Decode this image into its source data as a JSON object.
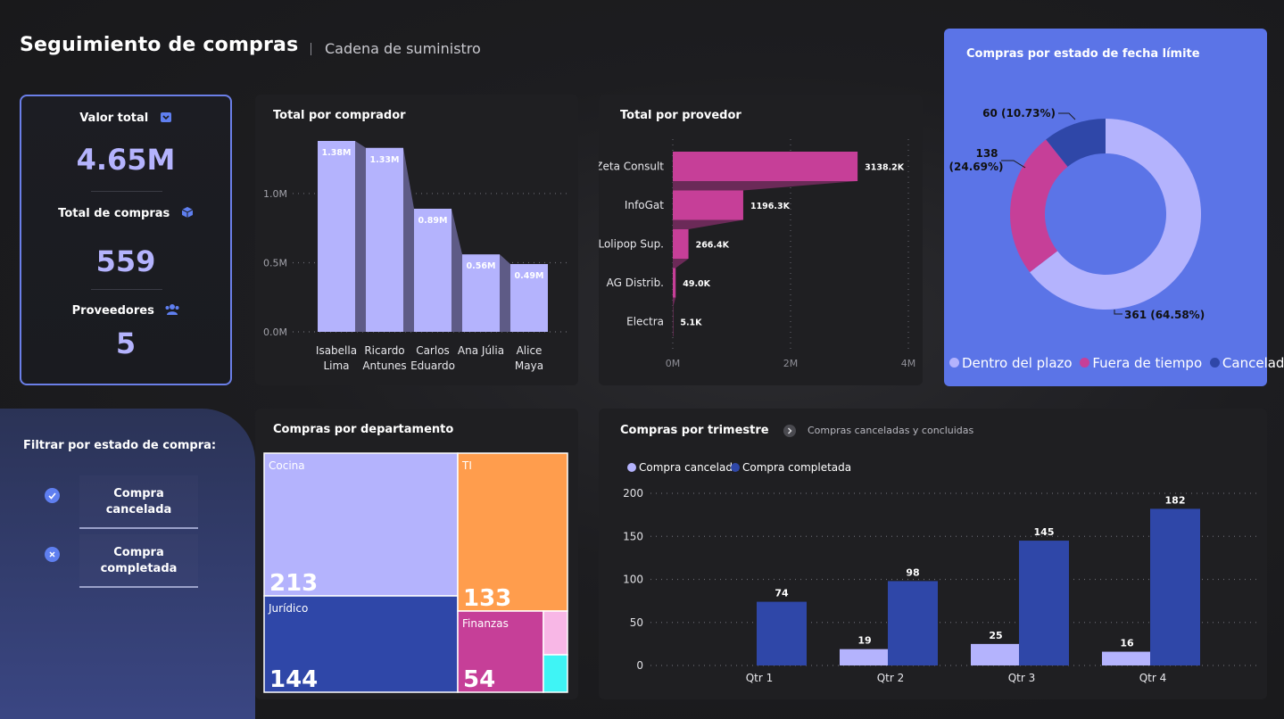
{
  "header": {
    "title": "Seguimiento de compras",
    "subtitle": "Cadena de suministro"
  },
  "kpis": {
    "total_value_label": "Valor total",
    "total_value": "4.65M",
    "total_purchases_label": "Total de compras",
    "total_purchases": "559",
    "suppliers_label": "Proveedores",
    "suppliers": "5"
  },
  "filters": {
    "title": "Filtrar por estado de compra:",
    "items": [
      {
        "line1": "Compra",
        "line2": "cancelada",
        "icon": "check-circle-icon"
      },
      {
        "line1": "Compra",
        "line2": "completada",
        "icon": "x-circle-icon"
      }
    ]
  },
  "colors": {
    "lavender": "#b4b3fd",
    "magenta": "#c63f98",
    "navy": "#2f47a8",
    "orange": "#ff9d4d",
    "donut_bg": "#5b74e7",
    "cyan": "#3ff4f5",
    "pink": "#f8b7e6"
  },
  "charts": {
    "buyer": {
      "title": "Total por comprador",
      "chart_data": {
        "type": "bar",
        "categories": [
          "Isabella Lima",
          "Ricardo Antunes",
          "Carlos Eduardo",
          "Ana Júlia",
          "Alice Maya"
        ],
        "category_lines": [
          [
            "Isabella",
            "Lima"
          ],
          [
            "Ricardo",
            "Antunes"
          ],
          [
            "Carlos",
            "Eduardo"
          ],
          [
            "Ana Júlia"
          ],
          [
            "Alice",
            "Maya"
          ]
        ],
        "values": [
          1.38,
          1.33,
          0.89,
          0.56,
          0.49
        ],
        "labels": [
          "1.38M",
          "1.33M",
          "0.89M",
          "0.56M",
          "0.49M"
        ],
        "yticks": [
          "0.0M",
          "0.5M",
          "1.0M"
        ],
        "ytick_values": [
          0,
          0.5,
          1.0
        ],
        "ylim": [
          0,
          1.38
        ]
      }
    },
    "supplier": {
      "title": "Total por provedor",
      "chart_data": {
        "type": "bar",
        "orientation": "horizontal",
        "categories": [
          "Zeta Consult",
          "InfoGat",
          "Lolipop Sup.",
          "AG Distrib.",
          "Electra"
        ],
        "values": [
          3138.2,
          1196.3,
          266.4,
          49.0,
          5.1
        ],
        "labels": [
          "3138.2K",
          "1196.3K",
          "266.4K",
          "49.0K",
          "5.1K"
        ],
        "xticks": [
          "0M",
          "2M",
          "4M"
        ],
        "xtick_values": [
          0,
          2000,
          4000
        ],
        "xlim": [
          0,
          4000
        ]
      }
    },
    "deadline": {
      "title": "Compras por estado de fecha límite",
      "chart_data": {
        "type": "pie",
        "categories": [
          "Dentro del plazo",
          "Fuera de tiempo",
          "Cancelada"
        ],
        "values": [
          361,
          138,
          60
        ],
        "labels": [
          "361 (64.58%)",
          "138",
          "(24.69%)",
          "60 (10.73%)"
        ],
        "legend": "bottom"
      }
    },
    "department": {
      "title": "Compras por departamento",
      "chart_data": {
        "type": "treemap",
        "categories": [
          "Cocina",
          "Jurídico",
          "TI",
          "Finanzas"
        ],
        "values": [
          213,
          144,
          133,
          54
        ]
      }
    },
    "quarter": {
      "title": "Compras por trimestre",
      "subtitle": "Compras canceladas y concluidas",
      "chart_data": {
        "type": "bar",
        "categories": [
          "Qtr 1",
          "Qtr 2",
          "Qtr 3",
          "Qtr 4"
        ],
        "series": [
          {
            "name": "Compra cancelada",
            "values": [
              null,
              19,
              25,
              16
            ]
          },
          {
            "name": "Compra completada",
            "values": [
              74,
              98,
              145,
              182
            ]
          }
        ],
        "yticks": [
          "0",
          "50",
          "100",
          "150",
          "200"
        ],
        "ytick_values": [
          0,
          50,
          100,
          150,
          200
        ],
        "ylim": [
          0,
          200
        ],
        "legend": "top-left"
      }
    }
  }
}
